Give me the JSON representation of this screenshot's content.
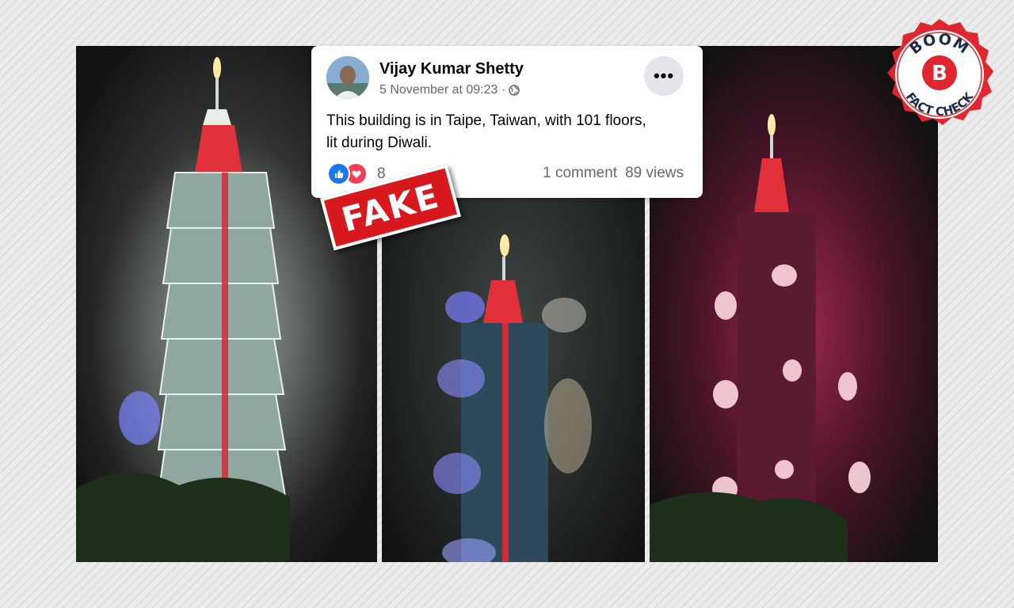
{
  "post": {
    "author": "Vijay Kumar Shetty",
    "timestamp": "5 November at 09:23 ·",
    "privacy_icon": "globe-icon",
    "more_label": "•••",
    "text_line1": "This building is in Taipe, Taiwan, with 101 floors,",
    "text_line2": "lit during Diwali.",
    "reaction_count": "8",
    "comments": "1 comment",
    "views": "89 views"
  },
  "stamp": {
    "label": "FAKE"
  },
  "badge": {
    "top_text": "BOOM",
    "bottom_text": "FACT CHECK",
    "letter": "B"
  },
  "colors": {
    "accent_red": "#d7191d",
    "like_blue": "#1877f2",
    "love_red": "#f33e58"
  }
}
